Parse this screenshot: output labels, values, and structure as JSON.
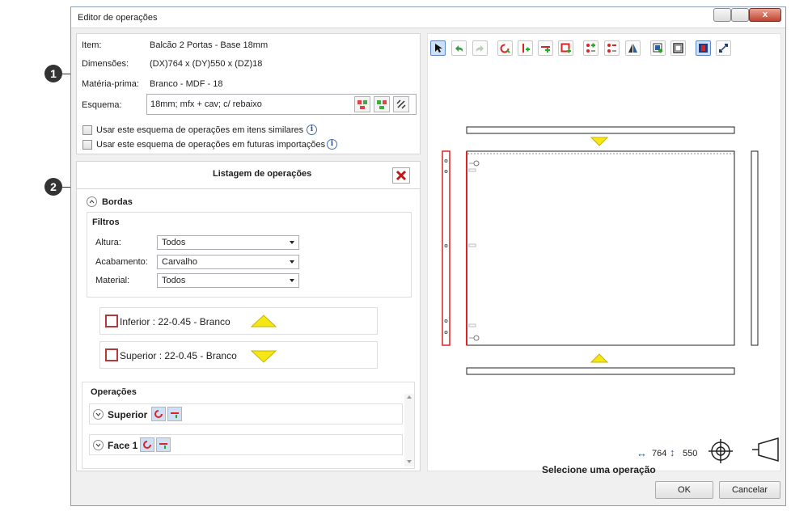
{
  "window": {
    "title": "Editor de operações"
  },
  "item_info": {
    "item_label": "Item:",
    "item_value": "Balcão 2 Portas - Base 18mm",
    "dim_label": "Dimensões:",
    "dim_value": "(DX)764 x (DY)550 x (DZ)18",
    "material_label": "Matéria-prima:",
    "material_value": "Branco - MDF - 18",
    "scheme_label": "Esquema:",
    "scheme_value": "18mm; mfx + cav; c/ rebaixo",
    "check_similar": "Usar este esquema de operações em itens similares",
    "check_future": "Usar este esquema de operações em futuras importações"
  },
  "listing": {
    "title": "Listagem de operações",
    "bordas_label": "Bordas",
    "filtros_label": "Filtros",
    "altura_label": "Altura:",
    "altura_value": "Todos",
    "acabamento_label": "Acabamento:",
    "acabamento_value": "Carvalho",
    "material_label": "Material:",
    "material_value": "Todos",
    "edges": [
      {
        "label": "Inferior : 22-0.45 - Branco"
      },
      {
        "label": "Superior : 22-0.45 - Branco"
      }
    ],
    "operacoes_label": "Operações",
    "operations": [
      {
        "label": "Superior"
      },
      {
        "label": "Face 1"
      }
    ]
  },
  "toolbar_icons": [
    "pointer-icon",
    "undo-icon",
    "redo-icon",
    "rotate-icon",
    "add-hole-icon",
    "add-groove-icon",
    "add-cut-icon",
    "add-drill-pattern-icon",
    "remove-drill-pattern-icon",
    "mirror-icon",
    "add-panel-icon",
    "panel-frame-icon",
    "panel-selected-icon",
    "expand-icon"
  ],
  "status": {
    "dx": "764",
    "dy": "550",
    "message": "Selecione uma operação"
  },
  "buttons": {
    "ok": "OK",
    "cancel": "Cancelar"
  },
  "callouts": [
    "1",
    "2"
  ],
  "colors": {
    "accent": "#cfe0f6",
    "edge_red": "#b33a3a",
    "triangle_yellow": "#f5e615"
  }
}
